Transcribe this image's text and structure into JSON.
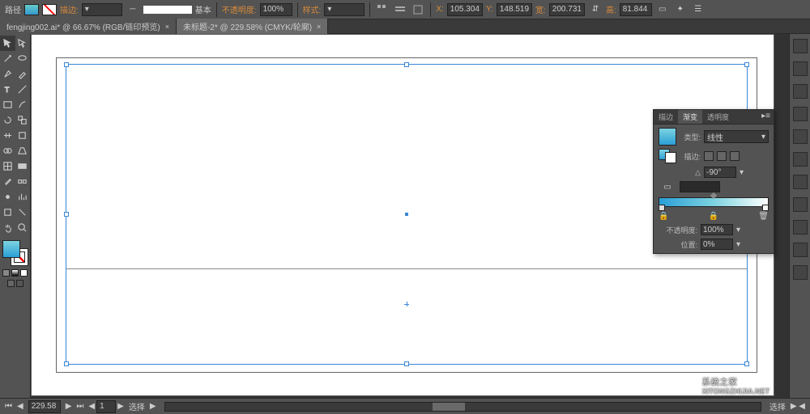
{
  "topbar": {
    "path_label": "路径",
    "fill_label": "描边:",
    "weight_label": "基本",
    "opacity_label": "不透明度:",
    "opacity_value": "100%",
    "style_label": "样式:",
    "x_label": "X:",
    "x_value": "105.304",
    "y_label": "Y:",
    "y_value": "148.519",
    "w_label": "宽:",
    "w_value": "200.731",
    "h_label": "高:",
    "h_value": "81.844"
  },
  "tabs": [
    {
      "label": "fengjing002.ai* @ 66.67% (RGB/链印预览)",
      "active": false
    },
    {
      "label": "未标题-2* @ 229.58% (CMYK/轮廓)",
      "active": true
    }
  ],
  "gradient_panel": {
    "tab_stroke": "描边",
    "tab_gradient": "渐变",
    "tab_transparency": "透明度",
    "type_label": "类型:",
    "type_value": "线性",
    "stroke_label": "描边:",
    "angle_value": "-90°",
    "opacity_label": "不透明度:",
    "opacity_value": "100%",
    "location_label": "位置:",
    "location_value": "0%"
  },
  "status": {
    "zoom": "229.58",
    "artboard_nav": "1",
    "tool": "选择",
    "tool2": "选择"
  },
  "watermark": {
    "main": "系统之家",
    "sub": "XITONGZHIJIA.NET"
  }
}
